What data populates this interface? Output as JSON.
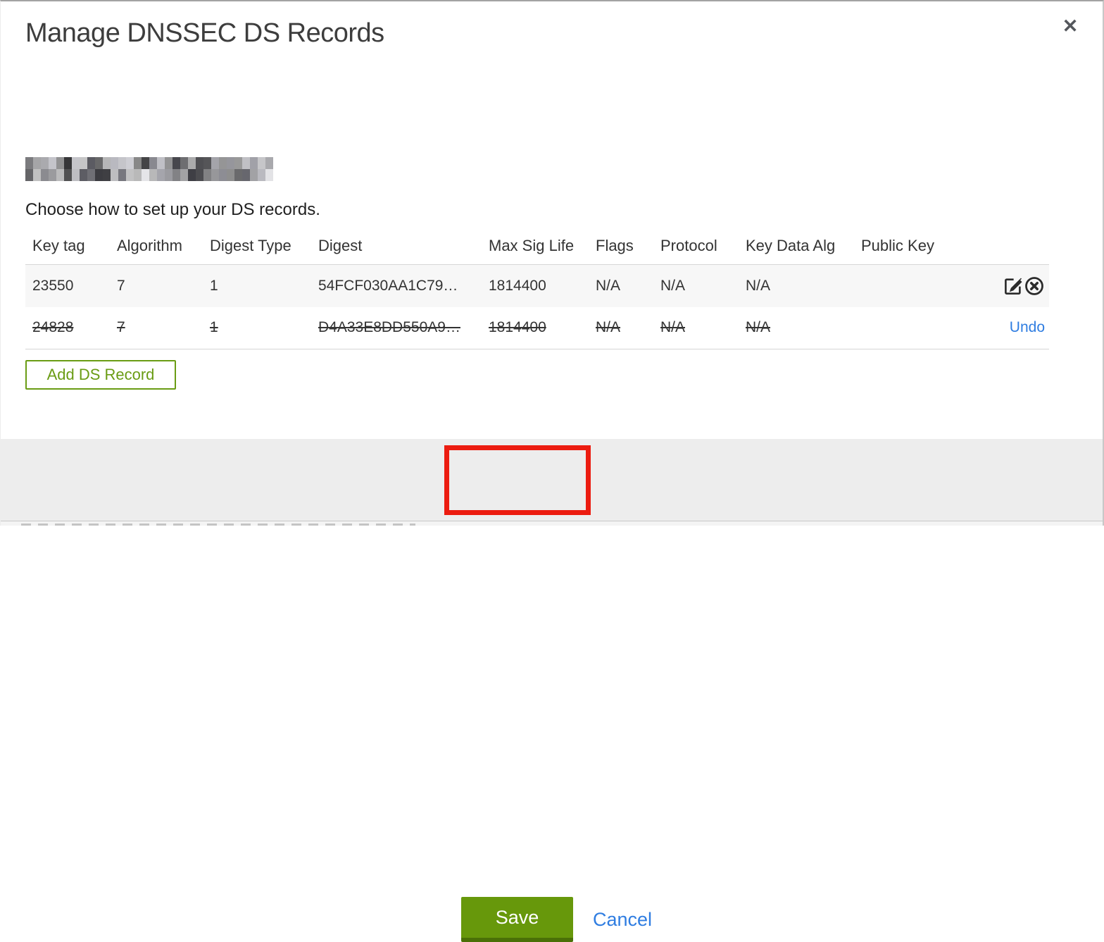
{
  "modal": {
    "title": "Manage DNSSEC DS Records",
    "close_glyph": "✕",
    "subtitle": "Choose how to set up your DS records.",
    "domain_name_redacted": true
  },
  "table": {
    "columns": [
      "Key tag",
      "Algorithm",
      "Digest Type",
      "Digest",
      "Max Sig Life",
      "Flags",
      "Protocol",
      "Key Data Alg",
      "Public Key"
    ],
    "rows": [
      {
        "key_tag": "23550",
        "algorithm": "7",
        "digest_type": "1",
        "digest": "54FCF030AA1C79…",
        "max_sig_life": "1814400",
        "flags": "N/A",
        "protocol": "N/A",
        "key_data_alg": "N/A",
        "public_key": "",
        "state": "normal",
        "actions": [
          "edit",
          "delete"
        ]
      },
      {
        "key_tag": "24828",
        "algorithm": "7",
        "digest_type": "1",
        "digest": "D4A33E8DD550A9…",
        "max_sig_life": "1814400",
        "flags": "N/A",
        "protocol": "N/A",
        "key_data_alg": "N/A",
        "public_key": "",
        "state": "deleted",
        "undo_label": "Undo"
      }
    ]
  },
  "buttons": {
    "add_ds_record": "Add DS Record",
    "save": "Save",
    "cancel": "Cancel"
  },
  "icons": {
    "edit": "edit-icon",
    "delete": "circle-x-icon",
    "close": "close-icon"
  },
  "colors": {
    "green_button": "#67980b",
    "green_button_shadow": "#4a7007",
    "green_outline": "#6a9c14",
    "link_blue": "#2f7de1",
    "annotation_red": "#ec1c10",
    "row_stripe": "#f7f7f7",
    "footer_gray": "#ededed"
  },
  "annotation": {
    "type": "highlight-rectangle",
    "target": "save-button"
  }
}
